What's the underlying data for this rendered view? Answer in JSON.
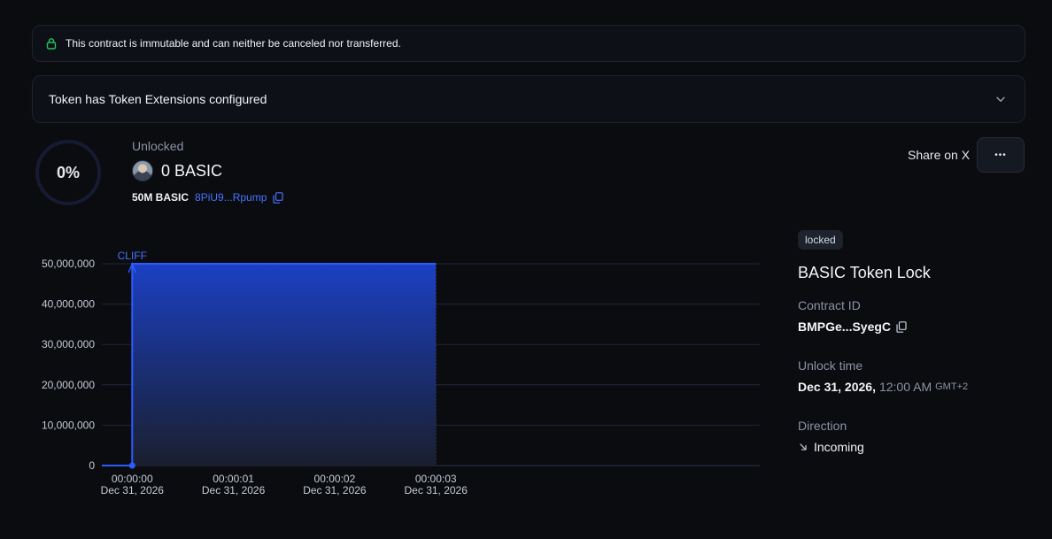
{
  "banner": {
    "text": "This contract is immutable and can neither be canceled nor transferred."
  },
  "extensions": {
    "label": "Token has Token Extensions configured"
  },
  "progress": {
    "percent_label": "0%",
    "percent": 0
  },
  "unlocked": {
    "label": "Unlocked",
    "amount": "0 BASIC",
    "total": "50M BASIC",
    "mint_address": "8PiU9...Rpump"
  },
  "actions": {
    "share_label": "Share on X",
    "more_label": "•••"
  },
  "details": {
    "status_badge": "locked",
    "title": "BASIC Token Lock",
    "contract_id_label": "Contract ID",
    "contract_id": "BMPGe...SyegC",
    "unlock_time_label": "Unlock time",
    "unlock_date": "Dec 31, 2026,",
    "unlock_clock": "12:00 AM",
    "unlock_tz": "GMT+2",
    "direction_label": "Direction",
    "direction": "Incoming"
  },
  "colors": {
    "accent": "#2e5bff",
    "chart_fill_top": "#1b40c4",
    "background": "#0a0c10"
  },
  "chart_data": {
    "type": "area",
    "annotation": "CLIFF",
    "y_ticks": [
      "0",
      "10,000,000",
      "20,000,000",
      "30,000,000",
      "40,000,000",
      "50,000,000"
    ],
    "ylim": [
      0,
      50000000
    ],
    "x_ticks": [
      {
        "time": "00:00:00",
        "date": "Dec 31, 2026"
      },
      {
        "time": "00:00:01",
        "date": "Dec 31, 2026"
      },
      {
        "time": "00:00:02",
        "date": "Dec 31, 2026"
      },
      {
        "time": "00:00:03",
        "date": "Dec 31, 2026"
      }
    ],
    "xlim": [
      -0.3,
      6.2
    ],
    "series": [
      {
        "x": [
          -0.3,
          0,
          0,
          3
        ],
        "y": [
          0,
          0,
          50000000,
          50000000
        ]
      }
    ],
    "marker": {
      "x": 0,
      "y": 0
    },
    "grid": true
  }
}
